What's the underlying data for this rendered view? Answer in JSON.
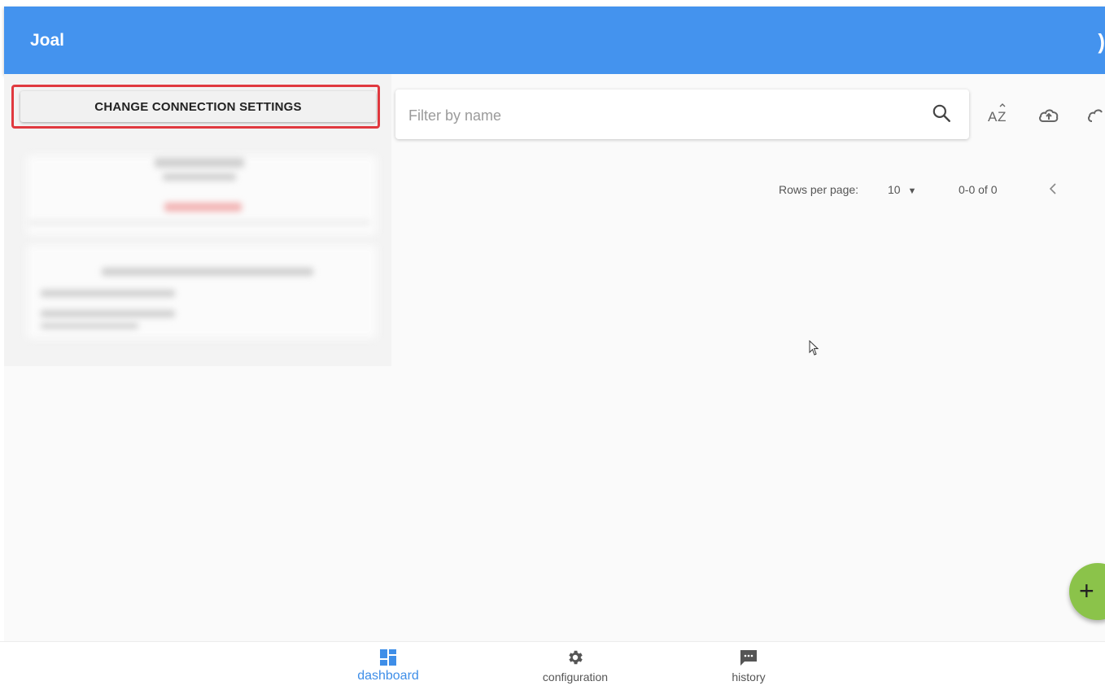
{
  "app_bar": {
    "title": "Joal",
    "color": "#4493ee",
    "right_icon": "sun-icon"
  },
  "left_panel": {
    "change_connection_button": "CHANGE CONNECTION SETTINGS",
    "highlight_color": "#e0393f"
  },
  "search": {
    "placeholder": "Filter by name",
    "value": ""
  },
  "toolbar": {
    "icons": [
      "search-icon",
      "sort-az-icon",
      "cloud-upload-icon",
      "cloud-icon"
    ]
  },
  "pagination": {
    "rows_per_page_label": "Rows per page:",
    "rows_per_page_value": "10",
    "range": "0-0 of 0"
  },
  "fab": {
    "icon": "plus-icon",
    "color": "#8bc34a"
  },
  "bottom_nav": {
    "items": [
      {
        "label": "dashboard",
        "icon": "dashboard-icon",
        "active": true
      },
      {
        "label": "configuration",
        "icon": "gear-icon",
        "active": false
      },
      {
        "label": "history",
        "icon": "chat-icon",
        "active": false
      }
    ],
    "active_color": "#3e8ee8"
  }
}
